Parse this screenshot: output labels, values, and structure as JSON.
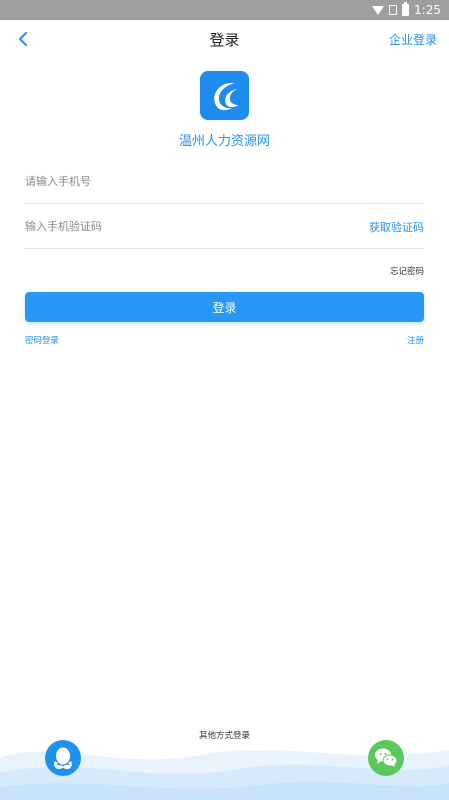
{
  "status_bar": {
    "time": "1:25"
  },
  "nav": {
    "title": "登录",
    "corp_login": "企业登录"
  },
  "app": {
    "name": "温州人力资源网"
  },
  "form": {
    "phone_placeholder": "请输入手机号",
    "code_placeholder": "输入手机验证码",
    "get_code": "获取验证码",
    "forgot_password": "忘记密码",
    "login_button": "登录",
    "password_login": "密码登录",
    "register": "注册"
  },
  "other_login": {
    "label": "其他方式登录"
  },
  "colors": {
    "accent": "#2591f2",
    "button": "#2997f5",
    "qq": "#2191f0",
    "wechat": "#5bc85e",
    "status_bar": "#9e9e9e"
  },
  "icons": [
    "back-arrow-icon",
    "app-logo-icon",
    "qq-icon",
    "wechat-icon",
    "wifi-icon",
    "no-sim-icon",
    "battery-icon"
  ]
}
